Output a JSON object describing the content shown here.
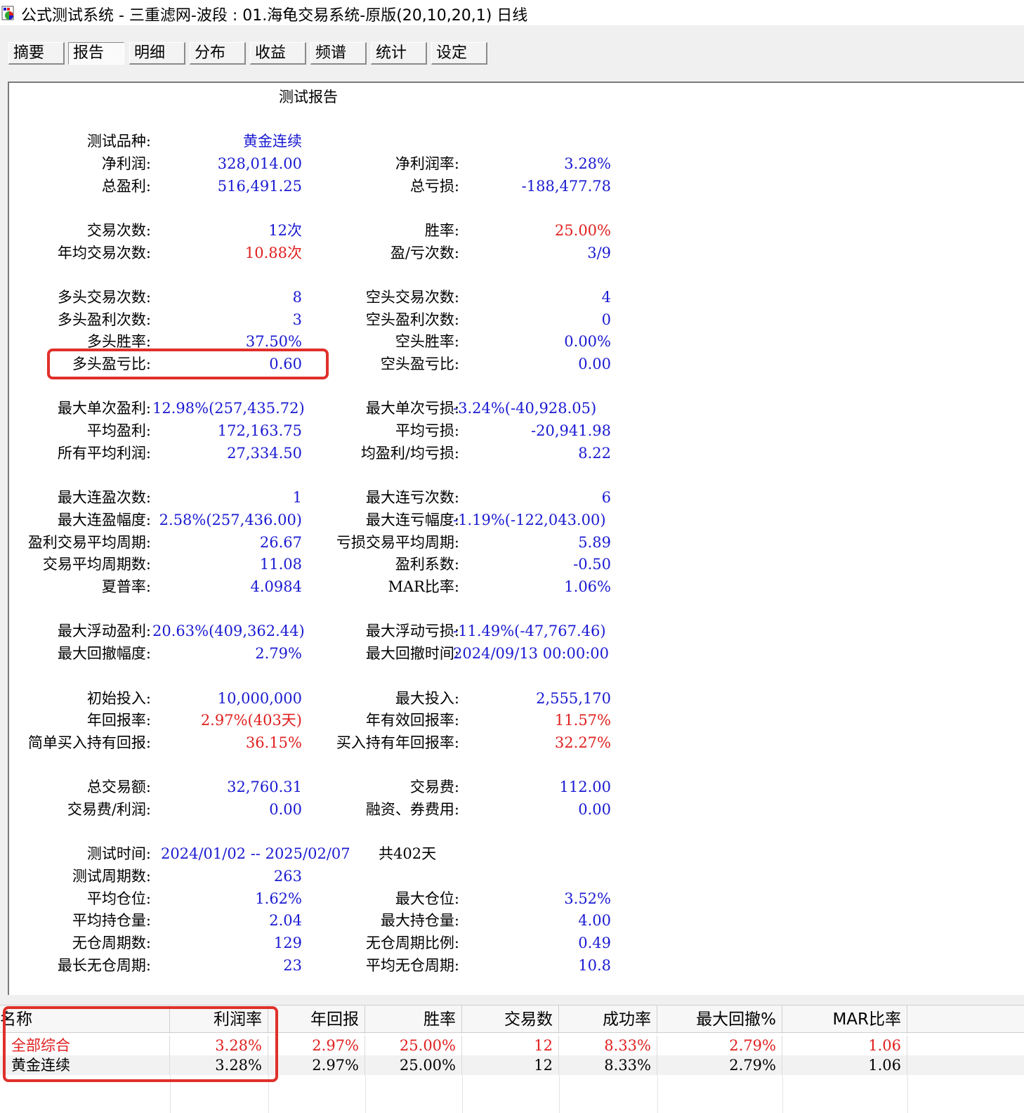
{
  "window": {
    "title": "公式测试系统 - 三重滤网-波段 : 01.海龟交易系统-原版(20,10,20,1) 日线"
  },
  "tabs": [
    "摘要",
    "报告",
    "明细",
    "分布",
    "收益",
    "频谱",
    "统计",
    "设定"
  ],
  "active_tab": "报告",
  "report": {
    "title": "测试报告",
    "instrument_label": "测试品种:",
    "instrument_value": "黄金连续",
    "net_profit_label": "净利润:",
    "net_profit_value": "328,014.00",
    "net_profit_rate_label": "净利润率:",
    "net_profit_rate_value": "3.28%",
    "gross_profit_label": "总盈利:",
    "gross_profit_value": "516,491.25",
    "gross_loss_label": "总亏损:",
    "gross_loss_value": "-188,477.78",
    "trades_label": "交易次数:",
    "trades_value": "12次",
    "win_rate_label": "胜率:",
    "win_rate_value": "25.00%",
    "annual_trades_label": "年均交易次数:",
    "annual_trades_value": "10.88次",
    "win_loss_count_label": "盈/亏次数:",
    "win_loss_count_value": "3/9",
    "long_trades_label": "多头交易次数:",
    "long_trades_value": "8",
    "short_trades_label": "空头交易次数:",
    "short_trades_value": "4",
    "long_wins_label": "多头盈利次数:",
    "long_wins_value": "3",
    "short_wins_label": "空头盈利次数:",
    "short_wins_value": "0",
    "long_win_rate_label": "多头胜率:",
    "long_win_rate_value": "37.50%",
    "short_win_rate_label": "空头胜率:",
    "short_win_rate_value": "0.00%",
    "long_pl_ratio_label": "多头盈亏比:",
    "long_pl_ratio_value": "0.60",
    "short_pl_ratio_label": "空头盈亏比:",
    "short_pl_ratio_value": "0.00",
    "max_single_profit_label": "最大单次盈利:",
    "max_single_profit_value": "12.98%(257,435.72)",
    "max_single_loss_label": "最大单次亏损:",
    "max_single_loss_value": "-3.24%(-40,928.05)",
    "avg_profit_label": "平均盈利:",
    "avg_profit_value": "172,163.75",
    "avg_loss_label": "平均亏损:",
    "avg_loss_value": "-20,941.98",
    "avg_net_label": "所有平均利润:",
    "avg_net_value": "27,334.50",
    "avg_ratio_label": "均盈利/均亏损:",
    "avg_ratio_value": "8.22",
    "max_consec_wins_label": "最大连盈次数:",
    "max_consec_wins_value": "1",
    "max_consec_losses_label": "最大连亏次数:",
    "max_consec_losses_value": "6",
    "max_consec_win_amp_label": "最大连盈幅度:",
    "max_consec_win_amp_value": "2.58%(257,436.00)",
    "max_consec_loss_amp_label": "最大连亏幅度:",
    "max_consec_loss_amp_value": "-1.19%(-122,043.00)",
    "win_avg_period_label": "盈利交易平均周期:",
    "win_avg_period_value": "26.67",
    "loss_avg_period_label": "亏损交易平均周期:",
    "loss_avg_period_value": "5.89",
    "avg_period_label": "交易平均周期数:",
    "avg_period_value": "11.08",
    "profit_factor_label": "盈利系数:",
    "profit_factor_value": "-0.50",
    "sharpe_label": "夏普率:",
    "sharpe_value": "4.0984",
    "mar_label": "MAR比率:",
    "mar_value": "1.06%",
    "max_float_profit_label": "最大浮动盈利:",
    "max_float_profit_value": "20.63%(409,362.44)",
    "max_float_loss_label": "最大浮动亏损:",
    "max_float_loss_value": "-11.49%(-47,767.46)",
    "max_dd_label": "最大回撤幅度:",
    "max_dd_value": "2.79%",
    "max_dd_time_label": "最大回撤时间:",
    "max_dd_time_value": "2024/09/13  00:00:00",
    "initial_label": "初始投入:",
    "initial_value": "10,000,000",
    "max_invest_label": "最大投入:",
    "max_invest_value": "2,555,170",
    "annual_return_label": "年回报率:",
    "annual_return_value": "2.97%(403天)",
    "effective_return_label": "年有效回报率:",
    "effective_return_value": "11.57%",
    "bh_return_label": "简单买入持有回报:",
    "bh_return_value": "36.15%",
    "bh_annual_label": "买入持有年回报率:",
    "bh_annual_value": "32.27%",
    "turnover_label": "总交易额:",
    "turnover_value": "32,760.31",
    "fees_label": "交易费:",
    "fees_value": "112.00",
    "fee_profit_label": "交易费/利润:",
    "fee_profit_value": "0.00",
    "finance_label": "融资、券费用:",
    "finance_value": "0.00",
    "test_time_label": "测试时间:",
    "test_time_value": "2024/01/02 -- 2025/02/07",
    "test_days": "共402天",
    "test_periods_label": "测试周期数:",
    "test_periods_value": "263",
    "avg_position_label": "平均仓位:",
    "avg_position_value": "1.62%",
    "max_position_label": "最大仓位:",
    "max_position_value": "3.52%",
    "avg_hold_label": "平均持仓量:",
    "avg_hold_value": "2.04",
    "max_hold_label": "最大持仓量:",
    "max_hold_value": "4.00",
    "flat_periods_label": "无仓周期数:",
    "flat_periods_value": "129",
    "flat_ratio_label": "无仓周期比例:",
    "flat_ratio_value": "0.49",
    "longest_flat_label": "最长无仓周期:",
    "longest_flat_value": "23",
    "avg_flat_label": "平均无仓周期:",
    "avg_flat_value": "10.8"
  },
  "grid": {
    "columns": [
      "名称",
      "利润率",
      "年回报",
      "胜率",
      "交易数",
      "成功率",
      "最大回撤%",
      "MAR比率"
    ],
    "rows": [
      {
        "name": "全部综合",
        "profit_rate": "3.28%",
        "annual": "2.97%",
        "win_rate": "25.00%",
        "trades": "12",
        "success": "8.33%",
        "max_dd": "2.79%",
        "mar": "1.06"
      },
      {
        "name": "黄金连续",
        "profit_rate": "3.28%",
        "annual": "2.97%",
        "win_rate": "25.00%",
        "trades": "12",
        "success": "8.33%",
        "max_dd": "2.79%",
        "mar": "1.06"
      }
    ]
  },
  "colors": {
    "value_blue": "#1a1ad2",
    "value_red": "#e02020",
    "highlight_box": "#e0302a"
  }
}
